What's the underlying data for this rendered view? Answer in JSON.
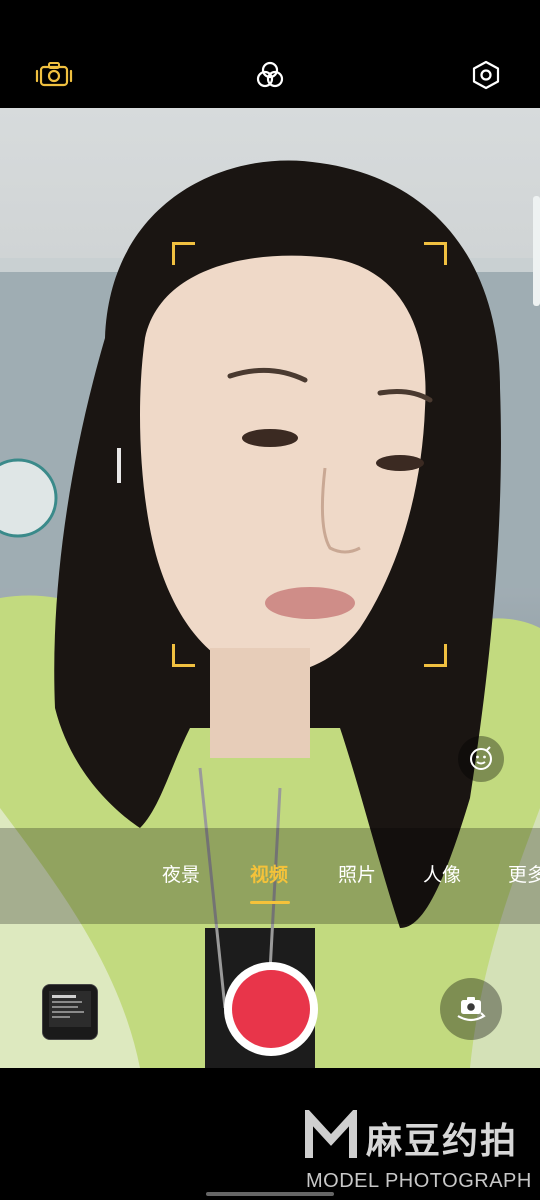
{
  "top_bar": {
    "icons": [
      "camera-settings-icon",
      "filter-icon",
      "settings-icon"
    ],
    "accent": "#f0c040"
  },
  "viewfinder": {
    "focus_color": "#f0c040"
  },
  "modes": {
    "items": [
      "夜景",
      "视频",
      "照片",
      "人像",
      "更多"
    ],
    "active": "视频",
    "active_color": "#f4c23a"
  },
  "controls": {
    "shutter_color": "#e8354a",
    "icons": [
      "gallery-thumbnail",
      "record-button",
      "switch-camera-icon",
      "beauty-icon"
    ]
  },
  "watermark": {
    "cn": "麻豆约拍",
    "en": "MODEL PHOTOGRAPH"
  }
}
